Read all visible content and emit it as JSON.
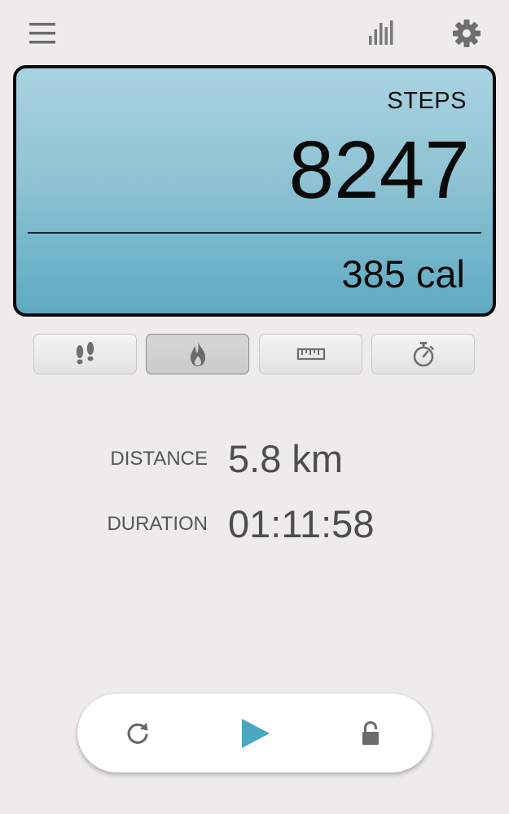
{
  "toolbar": {
    "menu_icon": "hamburger-menu-icon",
    "stats_icon": "bar-chart-icon",
    "settings_icon": "gear-icon"
  },
  "display": {
    "label": "STEPS",
    "value": "8247",
    "secondary": "385 cal",
    "gradient_top": "#a9d3e1",
    "gradient_bottom": "#5eaac2"
  },
  "mode_tabs": [
    {
      "name": "steps",
      "icon": "footprints-icon",
      "active": false
    },
    {
      "name": "calories",
      "icon": "flame-icon",
      "active": true
    },
    {
      "name": "distance",
      "icon": "ruler-icon",
      "active": false
    },
    {
      "name": "duration",
      "icon": "stopwatch-icon",
      "active": false
    }
  ],
  "stats": {
    "distance": {
      "label": "DISTANCE",
      "value": "5.8 km"
    },
    "duration": {
      "label": "DURATION",
      "value": "01:11:58"
    }
  },
  "controls": {
    "reset_icon": "refresh-icon",
    "play_icon": "play-icon",
    "lock_icon": "lock-icon",
    "accent": "#4aa6c1"
  }
}
